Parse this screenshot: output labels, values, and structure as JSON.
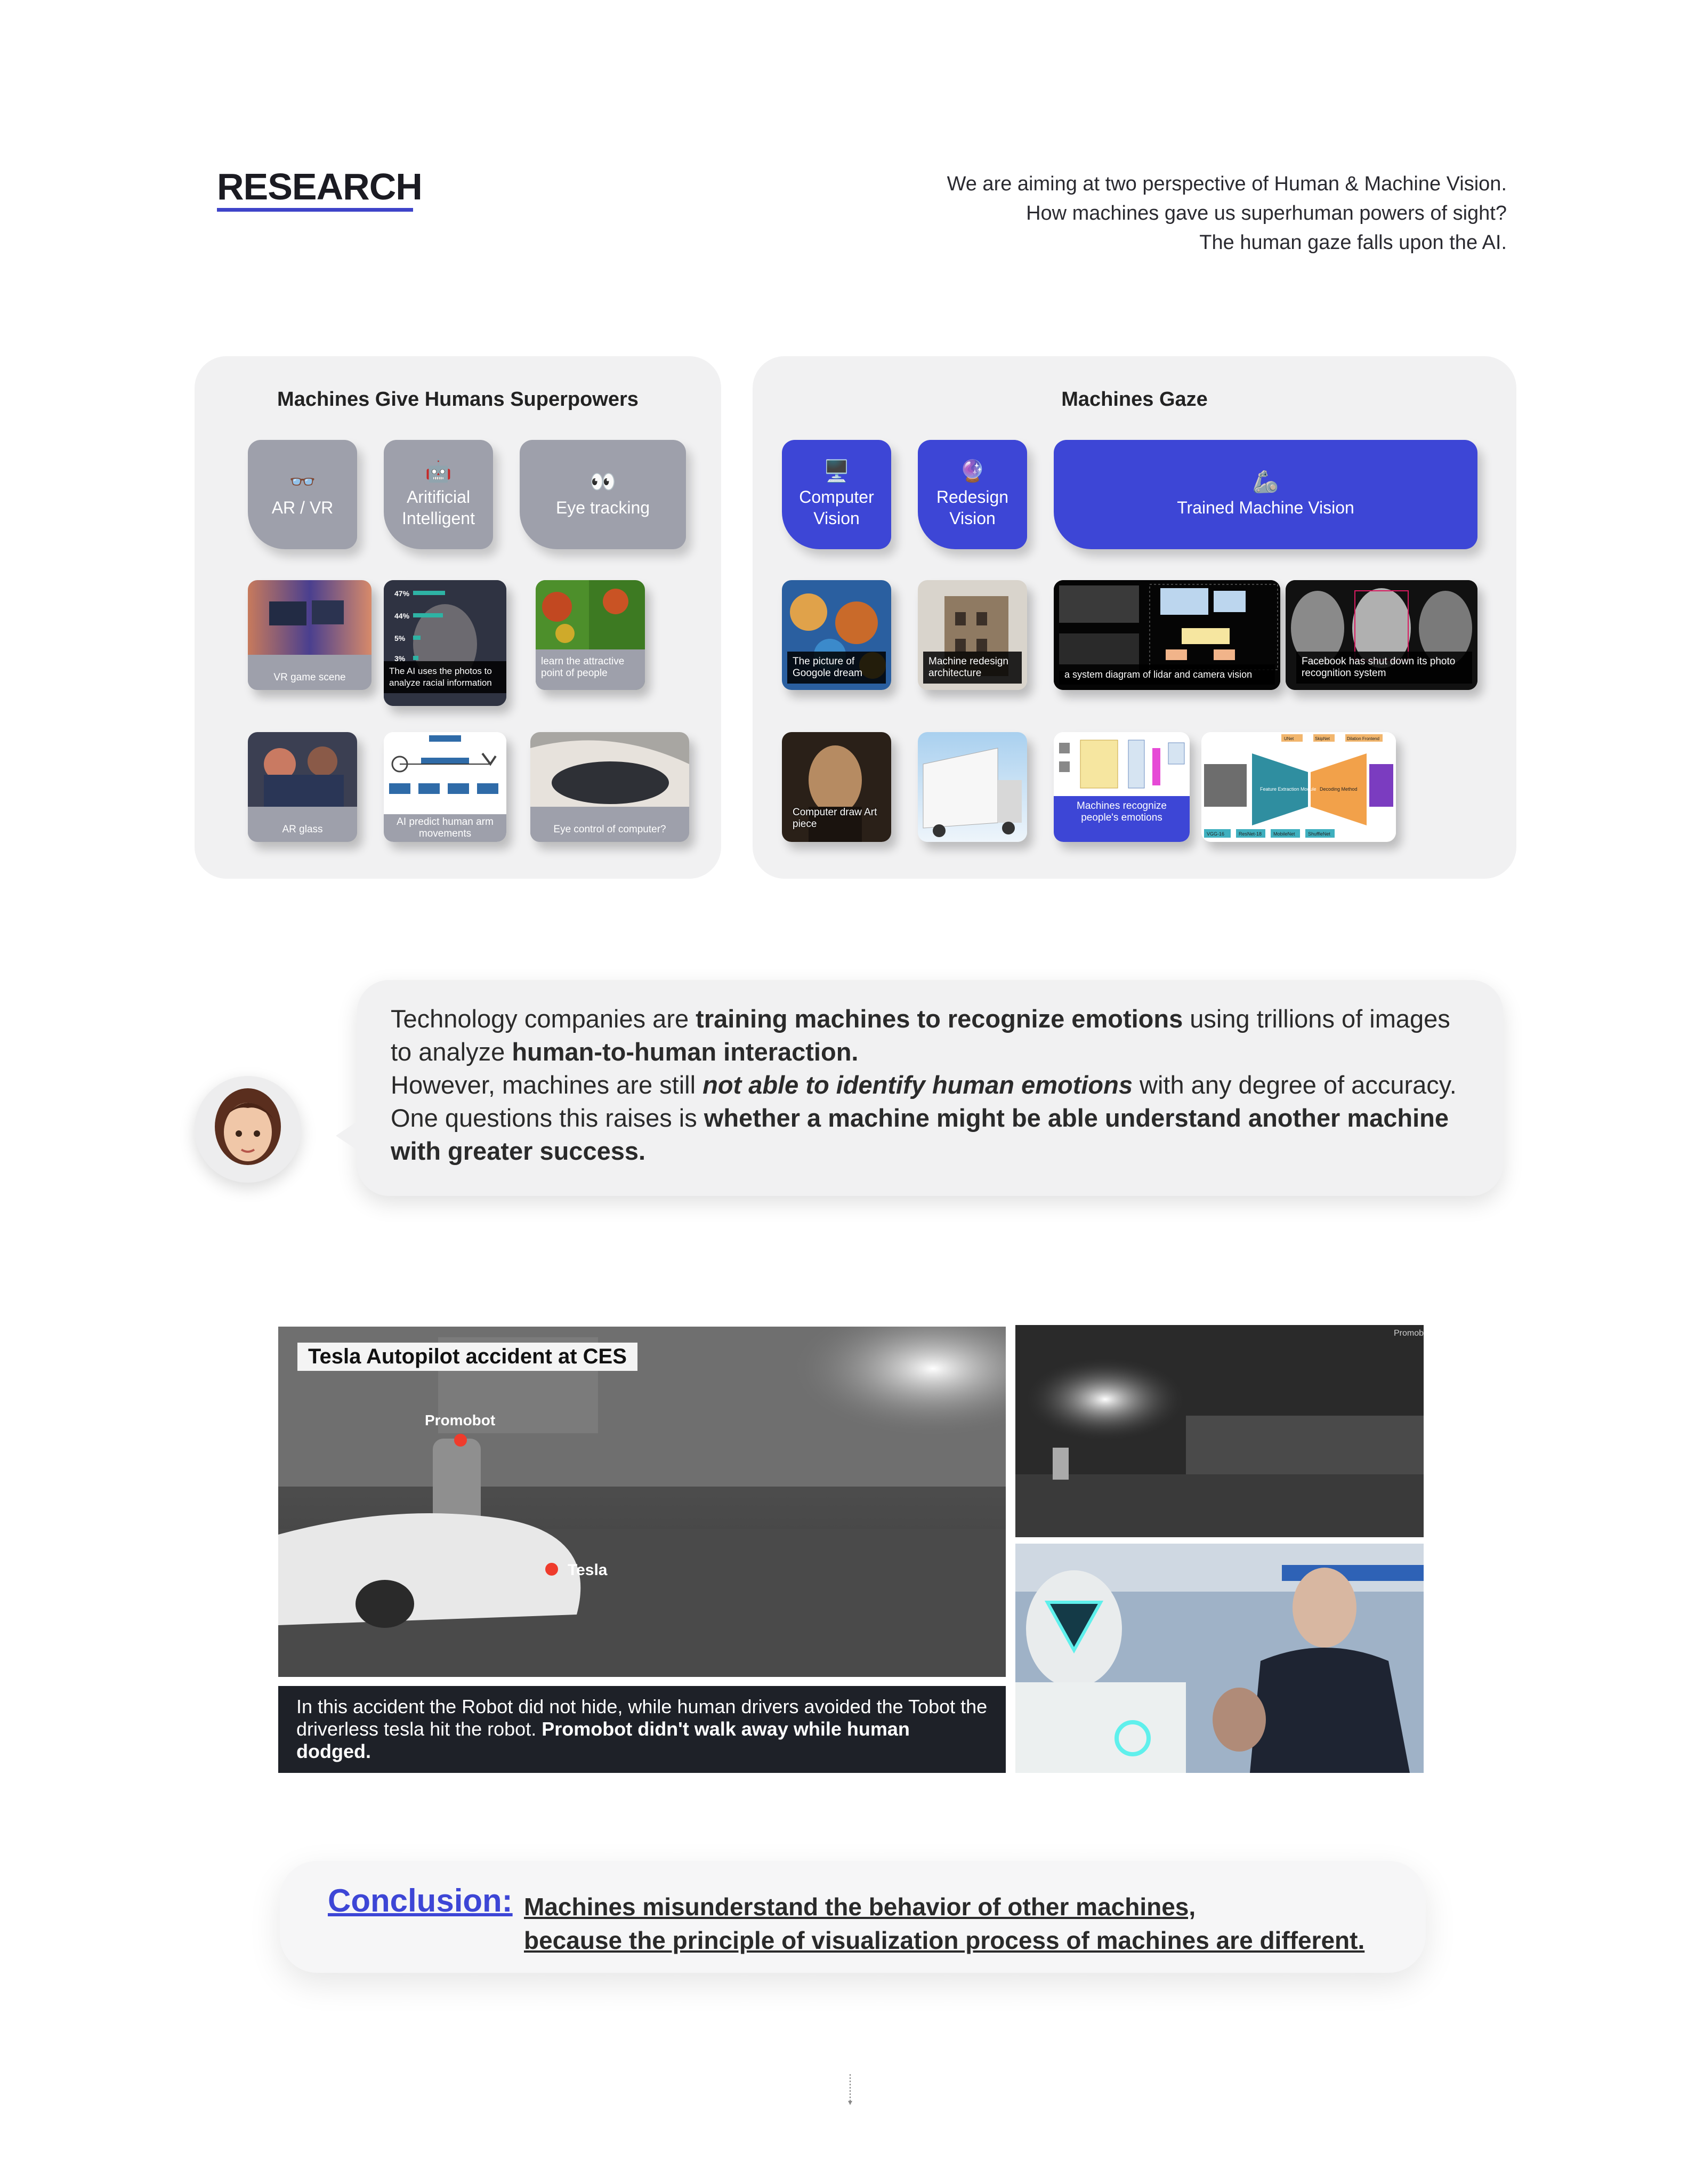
{
  "header": {
    "title": "RESEARCH",
    "intro_lines": [
      "We are aiming at two perspective of Human & Machine Vision.",
      "How machines gave us superhuman powers of sight?",
      "The human gaze falls upon the AI."
    ]
  },
  "left_panel": {
    "title": "Machines Give Humans Superpowers",
    "categories": [
      {
        "emoji": "👓",
        "label": "AR / VR"
      },
      {
        "emoji": "🤖",
        "label": "Aritificial Intelligent"
      },
      {
        "emoji": "👀",
        "label": "Eye tracking"
      }
    ],
    "cards": [
      "VR game scene",
      "The AI uses the photos to analyze racial information",
      "learn the attractive point of people",
      "AR glass",
      "AI predict human arm movements",
      "Eye control of computer?"
    ],
    "stats": [
      "47%",
      "44%",
      "5%",
      "3%"
    ]
  },
  "right_panel": {
    "title": "Machines Gaze",
    "categories": [
      {
        "emoji": "🖥️",
        "label": "Computer Vision"
      },
      {
        "emoji": "🔮",
        "label": "Redesign Vision"
      },
      {
        "emoji": "🦾",
        "label": "Trained Machine Vision"
      }
    ],
    "cards": [
      "The picture of Googole dream",
      "Machine redesign architecture",
      "a system diagram of lidar and camera vision",
      "Facebook has shut down its photo recognition system",
      "Computer draw Art piece",
      "Machines recognize people's emotions"
    ],
    "diagram_labels": [
      "UNet",
      "SkipNet",
      "Dilation Frontend",
      "Feature Extraction Module",
      "Decoding Method",
      "VGG-16",
      "ResNet-18",
      "MobileNet",
      "ShuffleNet"
    ]
  },
  "quote": {
    "p1_a": "Technology companies are ",
    "p1_b": "training machines to recognize emotions",
    "p1_c": " using trillions of images to analyze ",
    "p1_d": "human-to-human interaction.",
    "p2_a": "However, machines are still ",
    "p2_b": "not able to identify human emotions",
    "p2_c": " with any degree of accuracy.",
    "p3_a": "One questions this raises is ",
    "p3_b": "whether a machine might be able understand another machine with greater success."
  },
  "accident": {
    "tag": "Tesla Autopilot accident at CES",
    "label_robot": "Promobot",
    "label_car": "Tesla",
    "caption_plain": "In this accident the Robot did not hide, while human drivers avoided the Tobot the driverless tesla hit the robot. ",
    "caption_bold": "Promobot didn't walk away while human dodged.",
    "watermark": "Promob"
  },
  "conclusion": {
    "label": "Conclusion:",
    "line1": "Machines misunderstand the behavior of other machines,",
    "line2": "because the principle of visualization process of machines are different."
  },
  "colors": {
    "accent": "#3d46d6",
    "gray_card": "#9ea0ab",
    "panel": "#f1f1f2"
  }
}
